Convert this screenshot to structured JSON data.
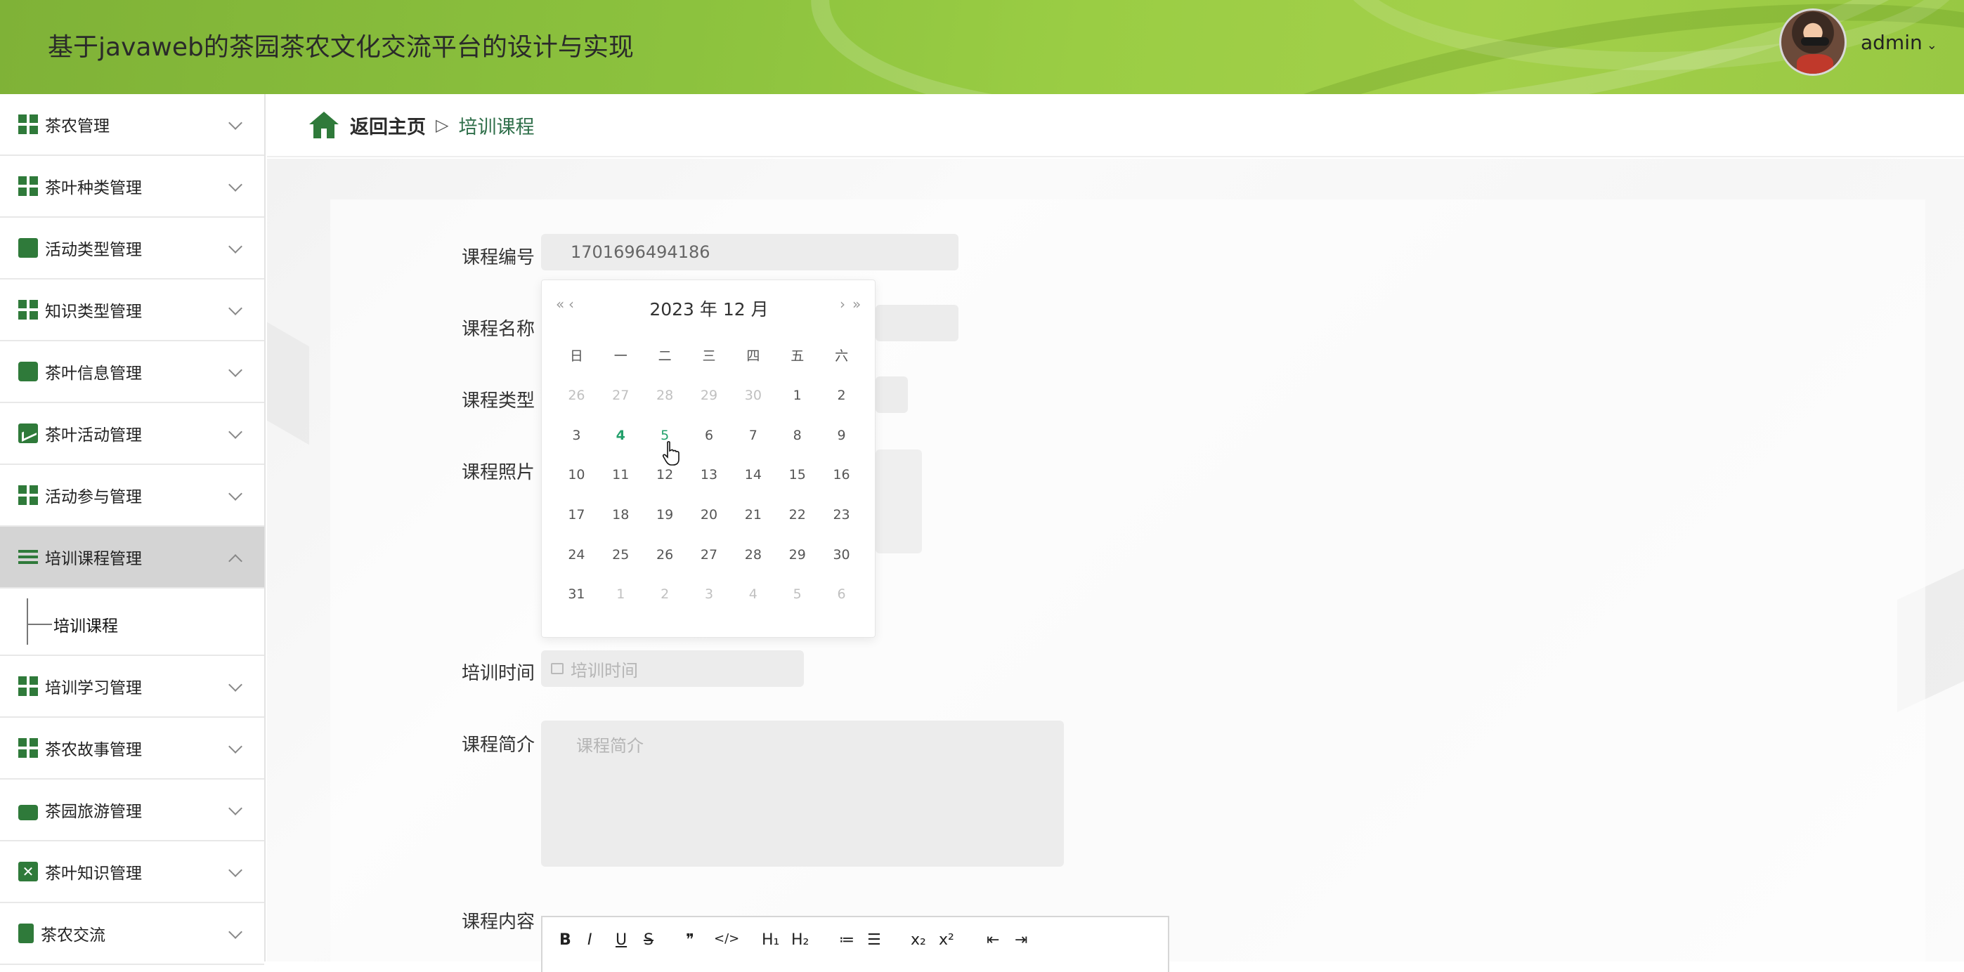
{
  "header": {
    "title": "基于javaweb的茶园茶农文化交流平台的设计与实现",
    "username": "admin",
    "dropdown_chevron": "⌄"
  },
  "sidebar": {
    "items": [
      {
        "label": "茶农管理",
        "icon": "grid-icon"
      },
      {
        "label": "茶叶种类管理",
        "icon": "grid-icon"
      },
      {
        "label": "活动类型管理",
        "icon": "ticket-icon"
      },
      {
        "label": "知识类型管理",
        "icon": "grid-icon"
      },
      {
        "label": "茶叶信息管理",
        "icon": "chat-icon"
      },
      {
        "label": "茶叶活动管理",
        "icon": "chart-icon"
      },
      {
        "label": "活动参与管理",
        "icon": "grid-icon"
      },
      {
        "label": "培训课程管理",
        "icon": "list-icon",
        "expanded": true
      },
      {
        "label": "培训学习管理",
        "icon": "grid-icon"
      },
      {
        "label": "茶农故事管理",
        "icon": "grid-icon"
      },
      {
        "label": "茶园旅游管理",
        "icon": "briefcase-icon"
      },
      {
        "label": "茶叶知识管理",
        "icon": "x-icon"
      },
      {
        "label": "茶农交流",
        "icon": "clipboard-icon"
      }
    ],
    "submenu": {
      "label": "培训课程"
    }
  },
  "breadcrumb": {
    "home": "返回主页",
    "separator": "▷",
    "current": "培训课程"
  },
  "form": {
    "course_no_label": "课程编号",
    "course_no_value": "1701696494186",
    "course_name_label": "课程名称",
    "course_type_label": "课程类型",
    "course_photo_label": "课程照片",
    "training_time_label": "培训时间",
    "training_time_placeholder": "培训时间",
    "intro_label": "课程简介",
    "intro_placeholder": "课程简介",
    "content_label": "课程内容"
  },
  "datepicker": {
    "prev_year": "«",
    "prev_month": "‹",
    "next_month": "›",
    "next_year": "»",
    "year": "2023 年",
    "month": "12 月",
    "weekdays": [
      "日",
      "一",
      "二",
      "三",
      "四",
      "五",
      "六"
    ],
    "weeks": [
      [
        "26",
        "27",
        "28",
        "29",
        "30",
        "1",
        "2"
      ],
      [
        "3",
        "4",
        "5",
        "6",
        "7",
        "8",
        "9"
      ],
      [
        "10",
        "11",
        "12",
        "13",
        "14",
        "15",
        "16"
      ],
      [
        "17",
        "18",
        "19",
        "20",
        "21",
        "22",
        "23"
      ],
      [
        "24",
        "25",
        "26",
        "27",
        "28",
        "29",
        "30"
      ],
      [
        "31",
        "1",
        "2",
        "3",
        "4",
        "5",
        "6"
      ]
    ],
    "today": "4",
    "hovered": "5",
    "accent_color": "#22a06b"
  },
  "editor": {
    "toolbar": [
      "B",
      "I",
      "U",
      "S",
      "❞",
      "</>",
      "H₁",
      "H₂",
      "≔",
      "☰",
      "x₂",
      "x²",
      "⇤",
      "⇥"
    ]
  },
  "colors": {
    "brand_green": "#8cc23e",
    "icon_green": "#2f7a3a",
    "active_menu_bg": "#d4d4d4"
  }
}
